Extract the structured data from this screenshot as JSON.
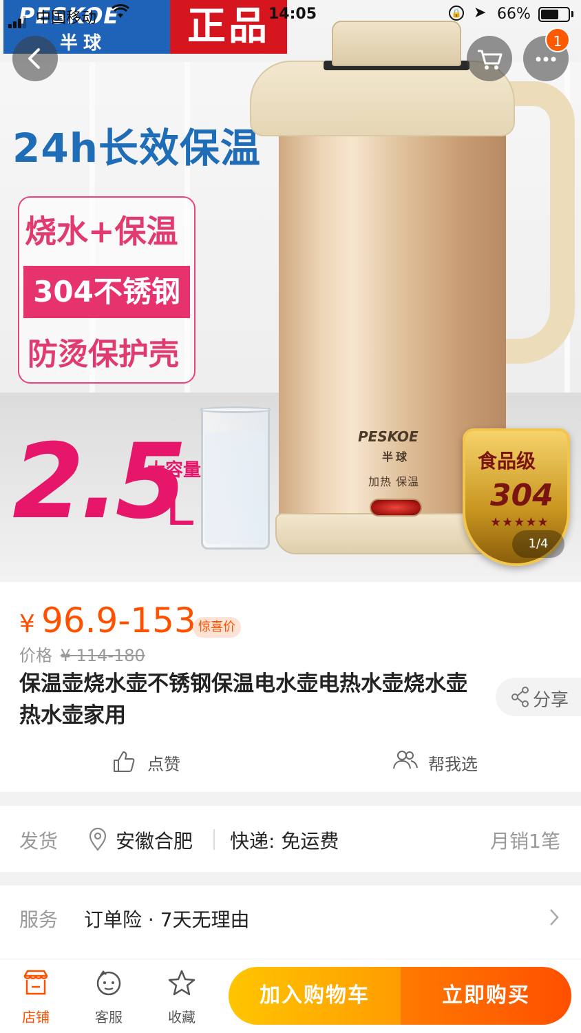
{
  "status_bar": {
    "carrier": "中国移动",
    "time": "14:05",
    "battery_percent": "66%",
    "battery_level": 0.66
  },
  "nav": {
    "back_icon": "chevron-left-icon",
    "cart_icon": "cart-icon",
    "more_icon": "more-icon",
    "more_badge": "1"
  },
  "hero": {
    "brand_name": "PESKOE",
    "brand_cn": "半球",
    "genuine_label": "正品",
    "headline": "24h长效保温",
    "features": [
      "烧水+保温",
      "304不锈钢",
      "防烫保护壳"
    ],
    "capacity_value": "2.5",
    "capacity_label": "大容量",
    "capacity_unit": "L",
    "kettle_brand": "PESKOE",
    "kettle_brand_cn": "半球",
    "kettle_label": "加热 保温",
    "badge_line1": "食品级",
    "badge_line2": "304",
    "badge_stars": "★★★★★",
    "counter": "1/4"
  },
  "product": {
    "currency": "¥",
    "price_range": "96.9-153",
    "price_tag": "惊喜价",
    "original_label": "价格",
    "original_price": "¥ 114-180",
    "title": "保温壶烧水壶不锈钢保温电水壶电热水壶烧水壶热水壶家用",
    "share_label": "分享",
    "like_label": "点赞",
    "help_choose_label": "帮我选"
  },
  "shipping": {
    "label": "发货",
    "location": "安徽合肥",
    "express": "快递: 免运费",
    "monthly_sales": "月销1笔"
  },
  "service": {
    "label": "服务",
    "text": "订单险 · 7天无理由"
  },
  "bottom_bar": {
    "store_label": "店铺",
    "service_label": "客服",
    "favorite_label": "收藏",
    "add_to_cart": "加入购物车",
    "buy_now": "立即购买"
  },
  "colors": {
    "accent": "#ff5000",
    "cart_button": "#ffb300",
    "buy_button": "#ff5f00"
  }
}
